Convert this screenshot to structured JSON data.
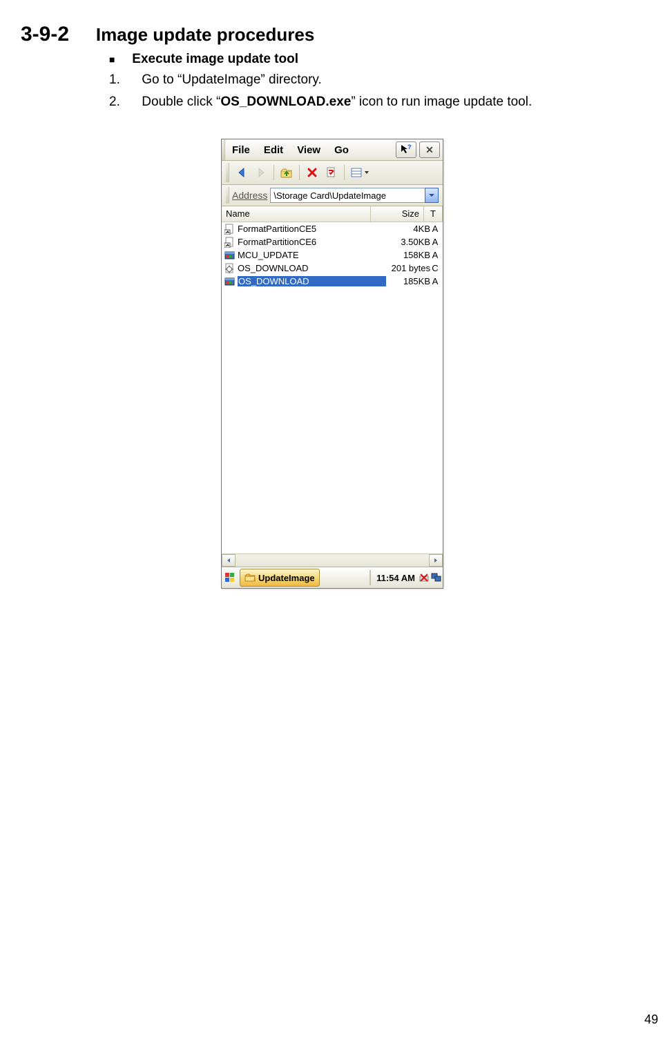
{
  "heading": {
    "number": "3-9-2",
    "title": "Image update procedures"
  },
  "subheading": "Execute image update tool",
  "steps": {
    "s1_prefix": "1.",
    "s1_text": "Go to “UpdateImage” directory.",
    "s2_prefix": "2.",
    "s2_a": "Double click “",
    "s2_bold": "OS_DOWNLOAD.exe",
    "s2_b": "” icon to run image update tool."
  },
  "window": {
    "menus": {
      "file": "File",
      "edit": "Edit",
      "view": "View",
      "go": "Go"
    },
    "address_label": "Address",
    "address_value": "\\Storage Card\\UpdateImage",
    "columns": {
      "name": "Name",
      "size": "Size",
      "t": "T"
    },
    "files": [
      {
        "name": "FormatPartitionCE5",
        "size": "4KB",
        "t": "A",
        "kind": "shortcut",
        "selected": false
      },
      {
        "name": "FormatPartitionCE6",
        "size": "3.50KB",
        "t": "A",
        "kind": "shortcut",
        "selected": false
      },
      {
        "name": "MCU_UPDATE",
        "size": "158KB",
        "t": "A",
        "kind": "exe-blue",
        "selected": false
      },
      {
        "name": "OS_DOWNLOAD",
        "size": "201 bytes",
        "t": "C",
        "kind": "config",
        "selected": false
      },
      {
        "name": "OS_DOWNLOAD",
        "size": "185KB",
        "t": "A",
        "kind": "exe-blue",
        "selected": true
      }
    ],
    "taskbar": {
      "button": "UpdateImage",
      "clock": "11:54 AM"
    }
  },
  "page_number": "49"
}
